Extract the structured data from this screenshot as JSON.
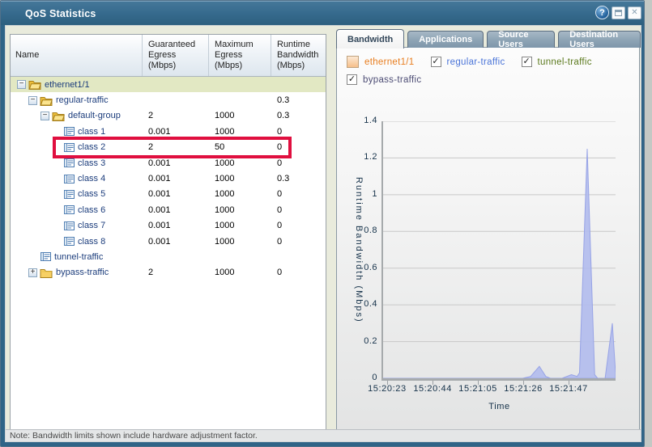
{
  "window": {
    "title": "QoS Statistics",
    "titlebar_icons": {
      "help": "?",
      "restore": "restore-window",
      "close": "✕"
    },
    "note": "Note: Bandwidth limits shown include hardware adjustment factor."
  },
  "table": {
    "columns": [
      "Name",
      "Guaranteed Egress (Mbps)",
      "Maximum Egress (Mbps)",
      "Runtime Bandwidth (Mbps)"
    ],
    "rows": [
      {
        "name": "ethernet1/1",
        "indent": 8,
        "expander": "minus",
        "icon": "folder-open",
        "guaranteed": "",
        "maximum": "",
        "runtime": "",
        "selected": true
      },
      {
        "name": "regular-traffic",
        "indent": 22,
        "expander": "minus",
        "icon": "folder-open",
        "guaranteed": "",
        "maximum": "",
        "runtime": "0.3"
      },
      {
        "name": "default-group",
        "indent": 37,
        "expander": "minus",
        "icon": "folder-open",
        "guaranteed": "2",
        "maximum": "1000",
        "runtime": "0.3"
      },
      {
        "name": "class 1",
        "indent": 66,
        "expander": "none",
        "icon": "class-doc",
        "guaranteed": "0.001",
        "maximum": "1000",
        "runtime": "0"
      },
      {
        "name": "class 2",
        "indent": 66,
        "expander": "none",
        "icon": "class-doc",
        "guaranteed": "2",
        "maximum": "50",
        "runtime": "0",
        "highlighted": true
      },
      {
        "name": "class 3",
        "indent": 66,
        "expander": "none",
        "icon": "class-doc",
        "guaranteed": "0.001",
        "maximum": "1000",
        "runtime": "0"
      },
      {
        "name": "class 4",
        "indent": 66,
        "expander": "none",
        "icon": "class-doc",
        "guaranteed": "0.001",
        "maximum": "1000",
        "runtime": "0.3"
      },
      {
        "name": "class 5",
        "indent": 66,
        "expander": "none",
        "icon": "class-doc",
        "guaranteed": "0.001",
        "maximum": "1000",
        "runtime": "0"
      },
      {
        "name": "class 6",
        "indent": 66,
        "expander": "none",
        "icon": "class-doc",
        "guaranteed": "0.001",
        "maximum": "1000",
        "runtime": "0"
      },
      {
        "name": "class 7",
        "indent": 66,
        "expander": "none",
        "icon": "class-doc",
        "guaranteed": "0.001",
        "maximum": "1000",
        "runtime": "0"
      },
      {
        "name": "class 8",
        "indent": 66,
        "expander": "none",
        "icon": "class-doc",
        "guaranteed": "0.001",
        "maximum": "1000",
        "runtime": "0"
      },
      {
        "name": "tunnel-traffic",
        "indent": 37,
        "expander": "none",
        "icon": "class-doc",
        "guaranteed": "",
        "maximum": "",
        "runtime": ""
      },
      {
        "name": "bypass-traffic",
        "indent": 22,
        "expander": "plus",
        "icon": "folder-closed",
        "guaranteed": "2",
        "maximum": "1000",
        "runtime": "0"
      }
    ]
  },
  "tabs": [
    {
      "label": "Bandwidth",
      "active": true
    },
    {
      "label": "Applications",
      "active": false
    },
    {
      "label": "Source Users",
      "active": false
    },
    {
      "label": "Destination Users",
      "active": false
    }
  ],
  "legend": [
    {
      "label": "ethernet1/1",
      "type": "swatch",
      "checked": false,
      "color": "#e87d1e"
    },
    {
      "label": "regular-traffic",
      "type": "checkbox",
      "checked": true,
      "color": "#4a74d8"
    },
    {
      "label": "tunnel-traffic",
      "type": "checkbox",
      "checked": true,
      "color": "#5c7a1e"
    },
    {
      "label": "bypass-traffic",
      "type": "checkbox",
      "checked": true,
      "color": "#4c4c74"
    }
  ],
  "chart_data": {
    "type": "area",
    "title": "",
    "xlabel": "Time",
    "ylabel": "Runtime Bandwidth (Mbps)",
    "ylim": [
      0,
      1.4
    ],
    "yticks": [
      0,
      0.2,
      0.4,
      0.6,
      0.8,
      1,
      1.2,
      1.4
    ],
    "grid": true,
    "legend_position": "top",
    "xticks": [
      {
        "label": "15:20:23",
        "frac": 0.017
      },
      {
        "label": "15:20:44",
        "frac": 0.213
      },
      {
        "label": "15:21:05",
        "frac": 0.408
      },
      {
        "label": "15:21:26",
        "frac": 0.603
      },
      {
        "label": "15:21:47",
        "frac": 0.798
      }
    ],
    "series": [
      {
        "name": "regular-traffic",
        "fill_color": "#b1bbed",
        "stroke_color": "#97a3e6",
        "points": [
          {
            "time": "15:20:21",
            "frac": 0.0,
            "value": 0
          },
          {
            "time": "15:21:25",
            "frac": 0.6,
            "value": 0
          },
          {
            "time": "15:21:29",
            "frac": 0.635,
            "value": 0.01
          },
          {
            "time": "15:21:33",
            "frac": 0.672,
            "value": 0.065
          },
          {
            "time": "15:21:36",
            "frac": 0.7,
            "value": 0.01
          },
          {
            "time": "15:21:38",
            "frac": 0.72,
            "value": 0
          },
          {
            "time": "15:21:43",
            "frac": 0.77,
            "value": 0
          },
          {
            "time": "15:21:48",
            "frac": 0.81,
            "value": 0.02
          },
          {
            "time": "15:21:50",
            "frac": 0.835,
            "value": 0.01
          },
          {
            "time": "15:21:51",
            "frac": 0.845,
            "value": 0.03
          },
          {
            "time": "15:21:55",
            "frac": 0.878,
            "value": 1.25
          },
          {
            "time": "15:21:58",
            "frac": 0.91,
            "value": 0.02
          },
          {
            "time": "15:22:00",
            "frac": 0.923,
            "value": 0
          },
          {
            "time": "15:22:03",
            "frac": 0.955,
            "value": 0
          },
          {
            "time": "15:22:07",
            "frac": 0.986,
            "value": 0.3
          },
          {
            "time": "15:22:08",
            "frac": 1.0,
            "value": 0.03
          }
        ]
      }
    ]
  }
}
